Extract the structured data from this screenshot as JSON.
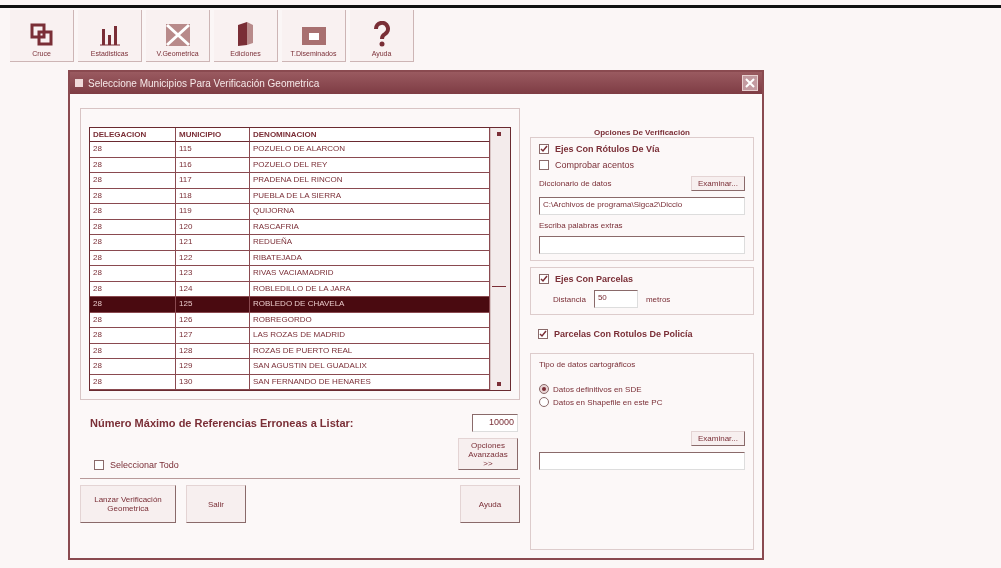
{
  "toolbar": [
    {
      "label": "Cruce",
      "kind": "cross"
    },
    {
      "label": "Estadisticas",
      "kind": "chart"
    },
    {
      "label": "V.Geometrica",
      "kind": "geometry"
    },
    {
      "label": "Ediciones",
      "kind": "edit"
    },
    {
      "label": "T.Diseminados",
      "kind": "box"
    },
    {
      "label": "Ayuda",
      "kind": "help"
    }
  ],
  "dialog": {
    "title": "Seleccione Municipios Para Verificación Geometrica",
    "table": {
      "columns": [
        "DELEGACION",
        "MUNICIPIO",
        "DENOMINACION"
      ],
      "rows": [
        {
          "cells": [
            "28",
            "115",
            "POZUELO DE ALARCON"
          ],
          "selected": false
        },
        {
          "cells": [
            "28",
            "116",
            "POZUELO DEL REY"
          ],
          "selected": false
        },
        {
          "cells": [
            "28",
            "117",
            "PRADENA DEL RINCON"
          ],
          "selected": false
        },
        {
          "cells": [
            "28",
            "118",
            "PUEBLA DE LA SIERRA"
          ],
          "selected": false
        },
        {
          "cells": [
            "28",
            "119",
            "QUIJORNA"
          ],
          "selected": false
        },
        {
          "cells": [
            "28",
            "120",
            "RASCAFRIA"
          ],
          "selected": false
        },
        {
          "cells": [
            "28",
            "121",
            "REDUEÑA"
          ],
          "selected": false
        },
        {
          "cells": [
            "28",
            "122",
            "RIBATEJADA"
          ],
          "selected": false
        },
        {
          "cells": [
            "28",
            "123",
            "RIVAS VACIAMADRID"
          ],
          "selected": false
        },
        {
          "cells": [
            "28",
            "124",
            "ROBLEDILLO DE LA JARA"
          ],
          "selected": false
        },
        {
          "cells": [
            "28",
            "125",
            "ROBLEDO DE CHAVELA"
          ],
          "selected": true
        },
        {
          "cells": [
            "28",
            "126",
            "ROBREGORDO"
          ],
          "selected": false
        },
        {
          "cells": [
            "28",
            "127",
            "LAS ROZAS DE MADRID"
          ],
          "selected": false
        },
        {
          "cells": [
            "28",
            "128",
            "ROZAS DE PUERTO REAL"
          ],
          "selected": false
        },
        {
          "cells": [
            "28",
            "129",
            "SAN AGUSTIN DEL GUADALIX"
          ],
          "selected": false
        },
        {
          "cells": [
            "28",
            "130",
            "SAN FERNANDO DE HENARES"
          ],
          "selected": false
        }
      ]
    },
    "max_errors": {
      "label": "Número Máximo de Referencias Erroneas a Listar:",
      "value": "10000"
    },
    "select_all": {
      "label": "Seleccionar Todo",
      "checked": false
    },
    "advanced_button": "Opciones Avanzadas >>",
    "buttons": [
      "Lanzar Verificación Geometrica",
      "Salir",
      "Ayuda"
    ],
    "options": {
      "title": "Opciones De Verificación",
      "axes_labels": {
        "label": "Ejes Con Rótulos De Vía",
        "checked": true
      },
      "check_accents": {
        "label": "Comprobar acentos",
        "checked": false
      },
      "dictionary": {
        "label": "Diccionario de datos",
        "button": "Examinar...",
        "value": "C:\\Archivos de programa\\Sigca2\\Diccio"
      },
      "extra_words": {
        "label": "Escriba palabras extras"
      },
      "axes_parcels": {
        "label": "Ejes Con Parcelas",
        "checked": true,
        "distance_label": "Distancia",
        "distance": "50",
        "unit": "metros"
      },
      "parcel_labels": {
        "label": "Parcelas Con Rotulos De Policía",
        "checked": true
      },
      "data_type": {
        "title": "Tipo de datos cartográficos",
        "choices": [
          {
            "label": "Datos definitivos en SDE",
            "selected": true
          },
          {
            "label": "Datos en Shapefile en este PC",
            "selected": false
          }
        ],
        "button": "Examinar..."
      }
    }
  }
}
